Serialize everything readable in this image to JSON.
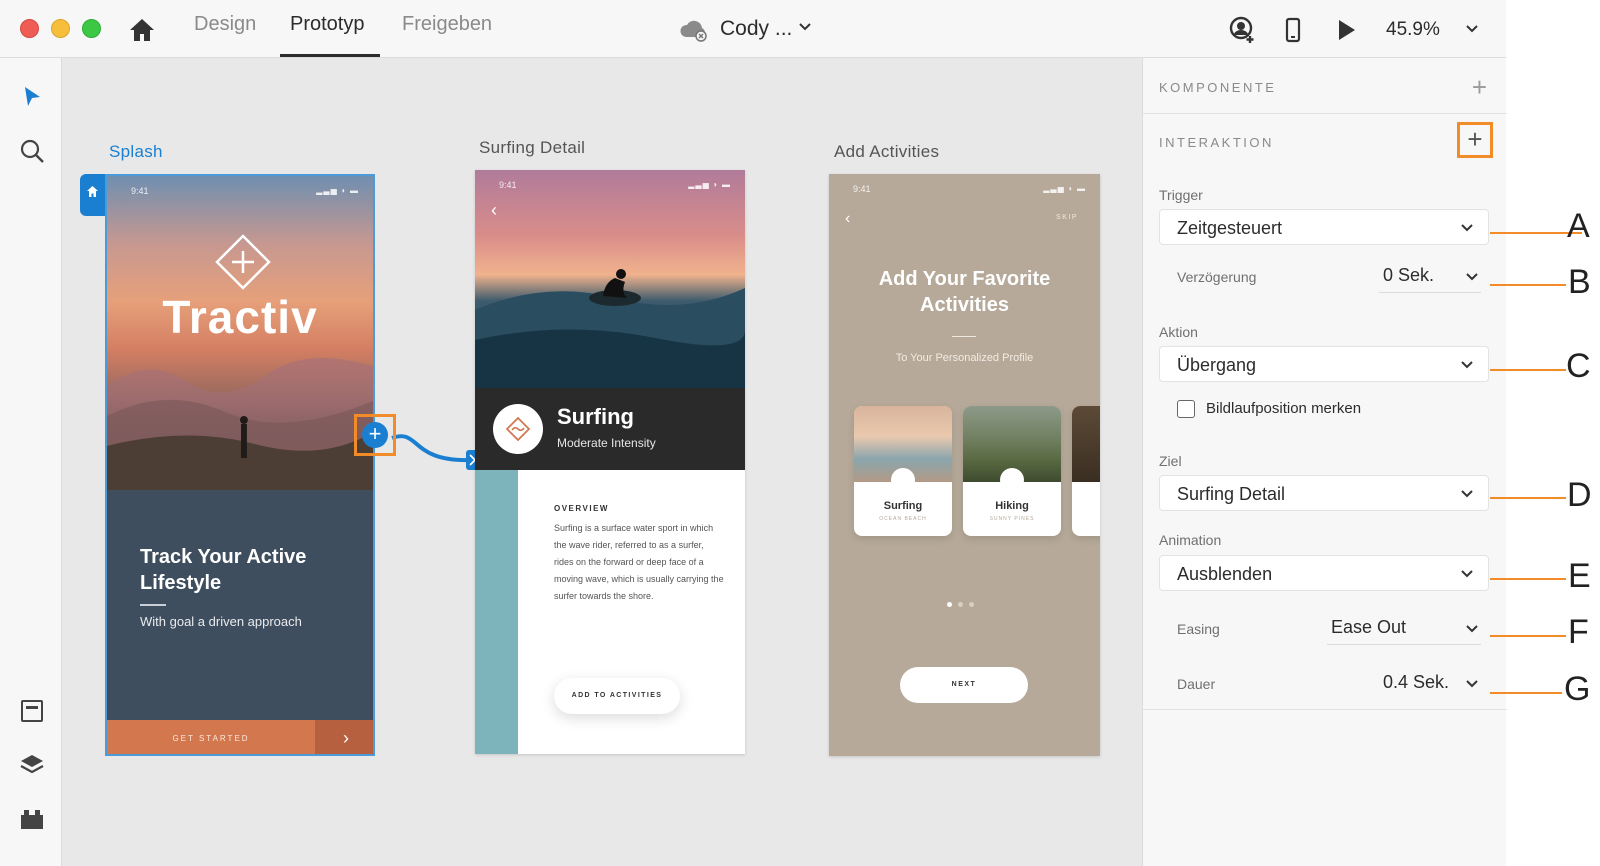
{
  "topbar": {
    "tabs": [
      {
        "label": "Design",
        "active": false
      },
      {
        "label": "Prototyp",
        "active": true
      },
      {
        "label": "Freigeben",
        "active": false
      }
    ],
    "doc_title": "Cody ...",
    "zoom": "45.9%",
    "icons": [
      "home-icon",
      "cloud-offline-icon",
      "share-user-icon",
      "device-preview-icon",
      "play-icon"
    ]
  },
  "left_toolbar": {
    "icons": [
      "select-arrow-icon",
      "search-icon",
      "assets-icon",
      "layers-icon",
      "plugins-icon"
    ]
  },
  "artboards": {
    "splash": {
      "label": "Splash",
      "time": "9:41",
      "brand": "Tractiv",
      "headline": "Track Your Active Lifestyle",
      "subline": "With goal a driven approach",
      "cta": "GET STARTED"
    },
    "surfing_detail": {
      "label": "Surfing Detail",
      "time": "9:41",
      "title": "Surfing",
      "subtitle": "Moderate Intensity",
      "overview_label": "OVERVIEW",
      "overview_text": "Surfing is a surface water sport in which the wave rider, referred to as a surfer, rides on the forward or deep face of a moving wave, which is usually carrying the surfer towards the shore.",
      "button": "ADD TO ACTIVITIES"
    },
    "add_activities": {
      "label": "Add Activities",
      "time": "9:41",
      "skip": "SKIP",
      "headline": "Add Your Favorite Activities",
      "subline": "To Your Personalized Profile",
      "cards": [
        {
          "name": "Surfing",
          "small": "OCEAN BEACH"
        },
        {
          "name": "Hiking",
          "small": "SUNNY PINES"
        }
      ],
      "button": "NEXT"
    }
  },
  "panel": {
    "komponente_label": "KOMPONENTE",
    "interaktion_label": "INTERAKTION",
    "trigger_label": "Trigger",
    "trigger_value": "Zeitgesteuert",
    "delay_label": "Verzögerung",
    "delay_value": "0 Sek.",
    "action_label": "Aktion",
    "action_value": "Übergang",
    "scroll_checkbox_label": "Bildlaufposition merken",
    "scroll_checkbox_checked": false,
    "target_label": "Ziel",
    "target_value": "Surfing Detail",
    "animation_label": "Animation",
    "animation_value": "Ausblenden",
    "easing_label": "Easing",
    "easing_value": "Ease Out",
    "duration_label": "Dauer",
    "duration_value": "0.4 Sek."
  },
  "annotations": [
    "A",
    "B",
    "C",
    "D",
    "E",
    "F",
    "G"
  ],
  "colors": {
    "accent_blue": "#1a7fd0",
    "highlight_orange": "#f28c28",
    "splash_cta": "#d3774f",
    "surf_teal": "#7db3ba",
    "add_bg": "#b6a999"
  }
}
